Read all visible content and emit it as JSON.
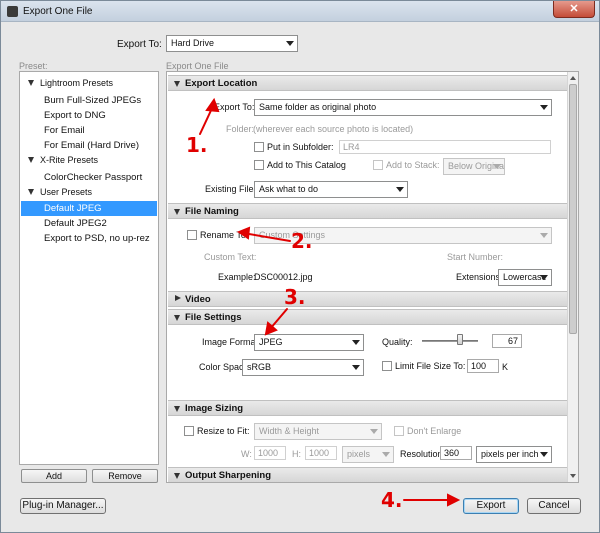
{
  "window": {
    "title": "Export One File",
    "close_glyph": "✕"
  },
  "export_to": {
    "label": "Export To:",
    "value": "Hard Drive"
  },
  "preset": {
    "header": "Preset:",
    "tree": [
      {
        "type": "folder",
        "label": "Lightroom Presets"
      },
      {
        "type": "item",
        "label": "Burn Full-Sized JPEGs"
      },
      {
        "type": "item",
        "label": "Export to DNG"
      },
      {
        "type": "item",
        "label": "For Email"
      },
      {
        "type": "item",
        "label": "For Email (Hard Drive)"
      },
      {
        "type": "folder",
        "label": "X-Rite Presets"
      },
      {
        "type": "item",
        "label": "ColorChecker Passport"
      },
      {
        "type": "folder",
        "label": "User Presets"
      },
      {
        "type": "item",
        "label": "Default JPEG",
        "selected": true
      },
      {
        "type": "item",
        "label": "Default JPEG2"
      },
      {
        "type": "item",
        "label": "Export to PSD, no up-rez"
      }
    ],
    "add_label": "Add",
    "remove_label": "Remove"
  },
  "panel_header": "Export One File",
  "export_location": {
    "title": "Export Location",
    "export_to_label": "Export To:",
    "export_to_value": "Same folder as original photo",
    "folder_label": "Folder:",
    "folder_value": "(wherever each source photo is located)",
    "subfolder_label": "Put in Subfolder:",
    "subfolder_value": "LR4",
    "add_catalog_label": "Add to This Catalog",
    "add_stack_label": "Add to Stack:",
    "stack_value": "Below Original",
    "existing_files_label": "Existing Files:",
    "existing_files_value": "Ask what to do"
  },
  "file_naming": {
    "title": "File Naming",
    "rename_label": "Rename To:",
    "rename_value": "Custom Settings",
    "custom_text_label": "Custom Text:",
    "start_number_label": "Start Number:",
    "example_label": "Example:",
    "example_value": "DSC00012.jpg",
    "extensions_label": "Extensions:",
    "extensions_value": "Lowercase"
  },
  "video": {
    "title": "Video"
  },
  "file_settings": {
    "title": "File Settings",
    "image_format_label": "Image Format:",
    "image_format_value": "JPEG",
    "quality_label": "Quality:",
    "quality_value": "67",
    "color_space_label": "Color Space:",
    "color_space_value": "sRGB",
    "limit_size_label": "Limit File Size To:",
    "limit_size_value": "100",
    "limit_size_unit": "K"
  },
  "image_sizing": {
    "title": "Image Sizing",
    "resize_label": "Resize to Fit:",
    "resize_value": "Width & Height",
    "dont_enlarge_label": "Don't Enlarge",
    "w_label": "W:",
    "w_value": "1000",
    "h_label": "H:",
    "h_value": "1000",
    "unit_value": "pixels",
    "resolution_label": "Resolution:",
    "resolution_value": "360",
    "resolution_unit": "pixels per inch"
  },
  "output_sharpening": {
    "title": "Output Sharpening"
  },
  "footer": {
    "plugin_manager_label": "Plug-in Manager...",
    "export_label": "Export",
    "cancel_label": "Cancel"
  },
  "annotations": {
    "color": "#e00000",
    "steps": [
      "1.",
      "2.",
      "3.",
      "4."
    ]
  }
}
